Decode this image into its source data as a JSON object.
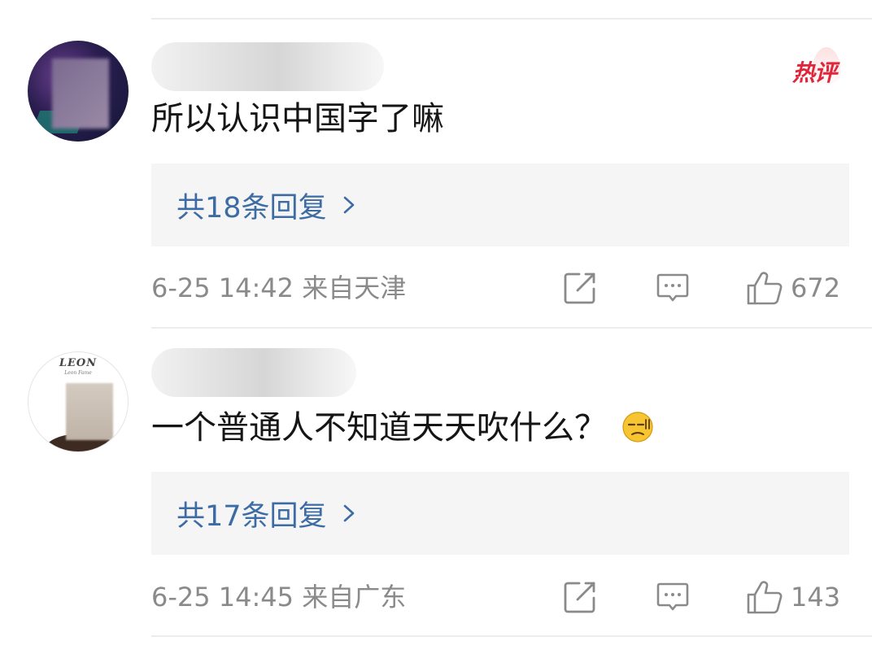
{
  "comments": [
    {
      "text": "所以认识中国字了嘛",
      "badge": "热评",
      "reply_summary": "共18条回复",
      "time_location": "6-25 14:42 来自天津",
      "likes": "672"
    },
    {
      "avatar_text": "LEON",
      "avatar_subtext": "Leon Fame",
      "text": "一个普通人不知道天天吹什么？",
      "reply_summary": "共17条回复",
      "time_location": "6-25 14:45 来自广东",
      "likes": "143"
    }
  ],
  "colors": {
    "reply_link": "#3d6ca5",
    "hot_badge": "#e0263a",
    "meta_text": "#8a8a8a",
    "reply_bg": "#f5f5f5"
  },
  "icons": {
    "share": "share-square-icon",
    "comment": "comment-bubble-icon",
    "like": "thumbs-up-icon",
    "chevron": "chevron-right-icon",
    "emoji": "emoji-smirk-icon"
  }
}
